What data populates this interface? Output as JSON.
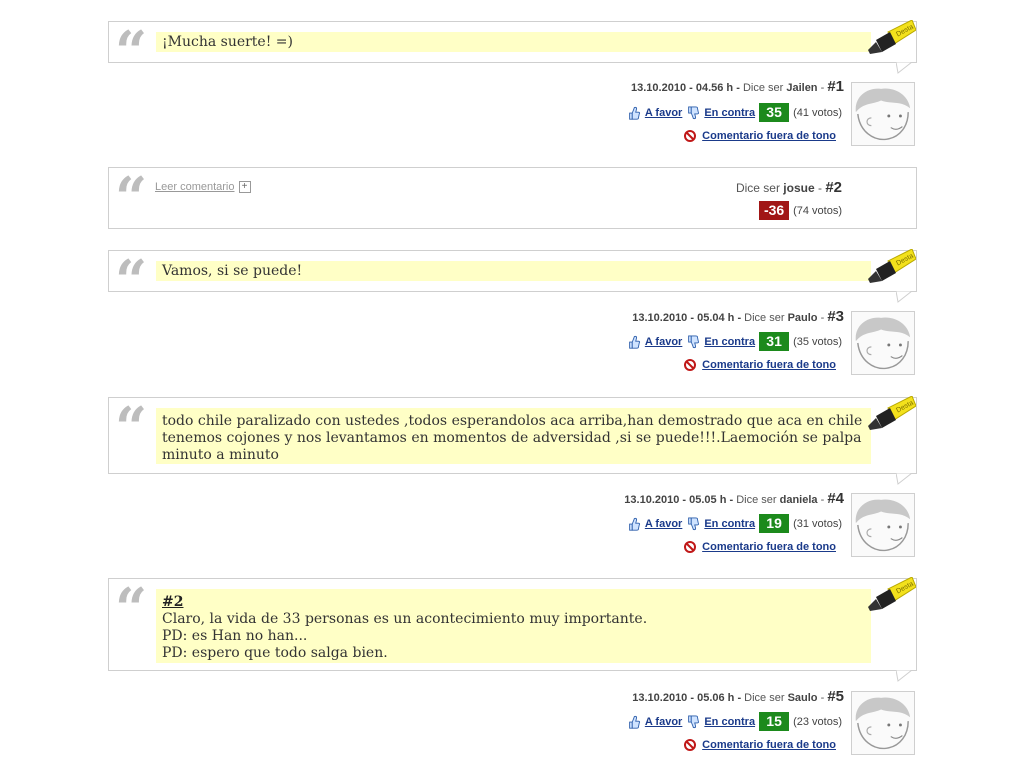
{
  "labels": {
    "dice_ser": "Dice ser",
    "a_favor": "A favor",
    "en_contra": "En contra",
    "fuera_de_tono": "Comentario fuera de tono",
    "leer_comentario": "Leer comentario"
  },
  "colors": {
    "highlight": "#ffffc6",
    "positive": "#1c8a1c",
    "negative": "#a11616",
    "link": "#1a3a8a"
  },
  "comments": [
    {
      "text": "¡Mucha suerte! =)",
      "date": "13.10.2010 - 04.56 h - ",
      "user": "Jailen",
      "number": "#1",
      "score": "35",
      "votes": "(41 votos)"
    },
    {
      "hidden": true,
      "user": "josue",
      "number": "#2",
      "score": "-36",
      "votes": "(74 votos)"
    },
    {
      "text": "Vamos, si se puede!",
      "date": "13.10.2010 - 05.04 h - ",
      "user": "Paulo",
      "number": "#3",
      "score": "31",
      "votes": "(35 votos)"
    },
    {
      "text": "todo chile paralizado con ustedes ,todos esperandolos aca arriba,han demostrado que aca en chile tenemos cojones y nos levantamos en momentos de adversidad ,si se puede!!!.Laemoción se palpa minuto a minuto",
      "date": "13.10.2010 - 05.05 h - ",
      "user": "daniela",
      "number": "#4",
      "score": "19",
      "votes": "(31 votos)"
    },
    {
      "ref": "#2",
      "lines": [
        "Claro, la vida de 33 personas es un acontecimiento muy importante.",
        "PD: es Han no han...",
        "PD: espero que todo salga bien."
      ],
      "date": "13.10.2010 - 05.06 h - ",
      "user": "Saulo",
      "number": "#5",
      "score": "15",
      "votes": "(23 votos)"
    }
  ]
}
